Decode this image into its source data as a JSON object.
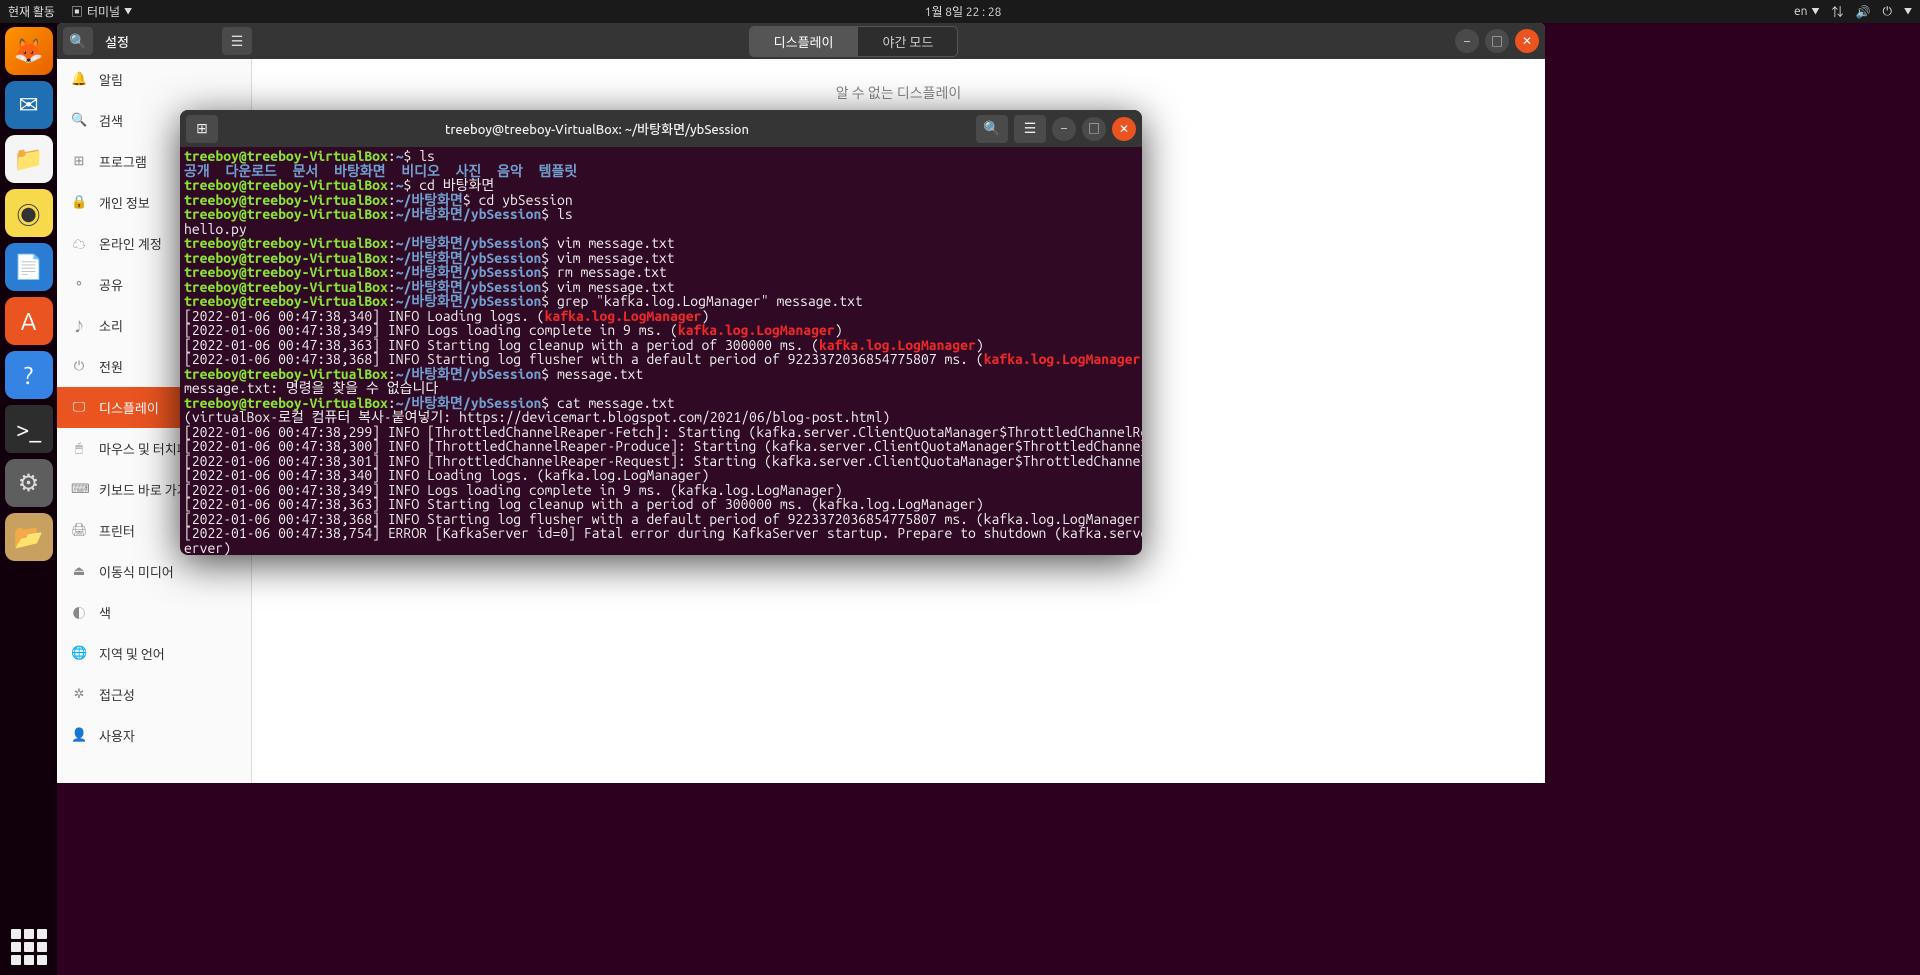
{
  "topbar": {
    "activities": "현재 활동",
    "terminal_menu": "터미널",
    "datetime": "1월 8일  22 : 28",
    "lang": "en"
  },
  "dock": {
    "items": [
      "firefox",
      "thunderbird",
      "files",
      "music",
      "writer",
      "software",
      "help",
      "terminal",
      "settings",
      "folder"
    ]
  },
  "settings": {
    "title": "설정",
    "segment": {
      "display": "디스플레이",
      "nightlight": "야간 모드"
    },
    "main_message": "알 수 없는 디스플레이",
    "sidebar": [
      {
        "icon": "🔔",
        "label": "알림"
      },
      {
        "icon": "🔍",
        "label": "검색"
      },
      {
        "icon": "⊞",
        "label": "프로그램"
      },
      {
        "icon": "🔒",
        "label": "개인 정보"
      },
      {
        "icon": "☁",
        "label": "온라인 계정"
      },
      {
        "icon": "⚬",
        "label": "공유"
      },
      {
        "icon": "♪",
        "label": "소리"
      },
      {
        "icon": "⏻",
        "label": "전원"
      },
      {
        "icon": "🖵",
        "label": "디스플레이",
        "active": true
      },
      {
        "icon": "🖱",
        "label": "마우스 및 터치패드"
      },
      {
        "icon": "⌨",
        "label": "키보드 바로 가기"
      },
      {
        "icon": "🖨",
        "label": "프린터"
      },
      {
        "icon": "⏏",
        "label": "이동식 미디어"
      },
      {
        "icon": "◐",
        "label": "색"
      },
      {
        "icon": "🌐",
        "label": "지역 및 언어"
      },
      {
        "icon": "✲",
        "label": "접근성"
      },
      {
        "icon": "👤",
        "label": "사용자"
      }
    ]
  },
  "terminal": {
    "title": "treeboy@treeboy-VirtualBox: ~/바탕화면/ybSession",
    "prompt_user": "treeboy@treeboy-VirtualBox",
    "prompt_home": "~",
    "prompt_desktop": "~/바탕화면",
    "prompt_session": "~/바탕화면/ybSession",
    "ls_output": {
      "dirs": [
        "공개",
        "다운로드",
        "문서",
        "바탕화면",
        "비디오",
        "사진",
        "음악",
        "템플릿"
      ],
      "file": "hello.py"
    },
    "commands": {
      "ls": "ls",
      "cd_desktop": "cd 바탕화면",
      "cd_session": "cd ybSession",
      "vim": "vim message.txt",
      "rm": "rm message.txt",
      "grep": "grep \"kafka.log.LogManager\" message.txt",
      "msg": "message.txt",
      "cat": "cat message.txt"
    },
    "grep_lines": [
      {
        "prefix": "[2022-01-06 00:47:38,340] INFO Loading logs. (",
        "highlight": "kafka.log.LogManager",
        "suffix": ")"
      },
      {
        "prefix": "[2022-01-06 00:47:38,349] INFO Logs loading complete in 9 ms. (",
        "highlight": "kafka.log.LogManager",
        "suffix": ")"
      },
      {
        "prefix": "[2022-01-06 00:47:38,363] INFO Starting log cleanup with a period of 300000 ms. (",
        "highlight": "kafka.log.LogManager",
        "suffix": ")"
      },
      {
        "prefix": "[2022-01-06 00:47:38,368] INFO Starting log flusher with a default period of 9223372036854775807 ms. (",
        "highlight": "kafka.log.LogManager",
        "suffix": ")"
      }
    ],
    "not_found": "message.txt: 명령을 찾을 수 없습니다",
    "cat_output": [
      "(virtualBox-로컬 컴퓨터 복사-붙여넣기: https://devicemart.blogspot.com/2021/06/blog-post.html)",
      "[2022-01-06 00:47:38,299] INFO [ThrottledChannelReaper-Fetch]: Starting (kafka.server.ClientQuotaManager$ThrottledChannelReaper)",
      "[2022-01-06 00:47:38,300] INFO [ThrottledChannelReaper-Produce]: Starting (kafka.server.ClientQuotaManager$ThrottledChannelReaper)",
      "[2022-01-06 00:47:38,301] INFO [ThrottledChannelReaper-Request]: Starting (kafka.server.ClientQuotaManager$ThrottledChannelReaper)",
      "[2022-01-06 00:47:38,340] INFO Loading logs. (kafka.log.LogManager)",
      "[2022-01-06 00:47:38,349] INFO Logs loading complete in 9 ms. (kafka.log.LogManager)",
      "[2022-01-06 00:47:38,363] INFO Starting log cleanup with a period of 300000 ms. (kafka.log.LogManager)",
      "[2022-01-06 00:47:38,368] INFO Starting log flusher with a default period of 9223372036854775807 ms. (kafka.log.LogManager)",
      "[2022-01-06 00:47:38,754] ERROR [KafkaServer id=0] Fatal error during KafkaServer startup. Prepare to shutdown (kafka.server.KafkaS",
      "erver)"
    ]
  }
}
